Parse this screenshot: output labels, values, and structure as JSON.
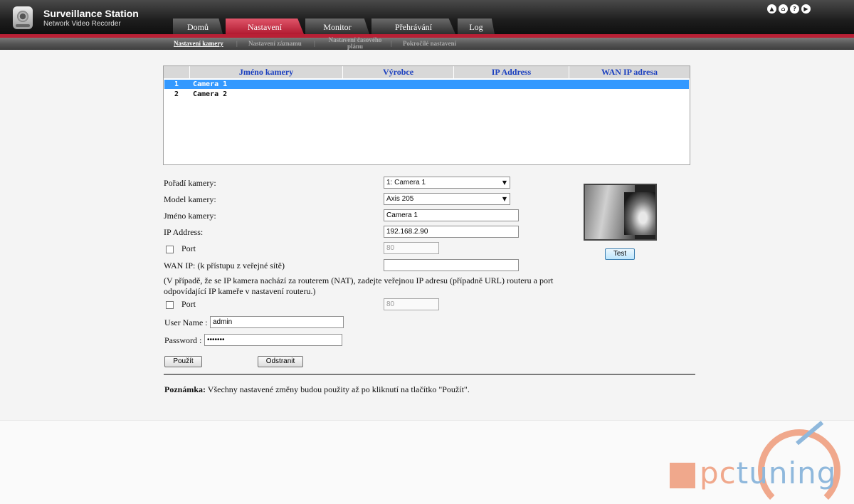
{
  "app": {
    "title": "Surveillance Station",
    "subtitle": "Network Video Recorder"
  },
  "top_icons": [
    "up-arrow-icon",
    "home-icon",
    "help-icon",
    "logout-icon"
  ],
  "tabs": [
    "Domů",
    "Nastavení",
    "Monitor",
    "Přehrávání",
    "Log"
  ],
  "active_tab": "Nastavení",
  "subnav": {
    "items": [
      "Nastavení kamery",
      "Nastavení záznamu",
      "Nastavení časového plánu",
      "Pokročilé nastavení"
    ],
    "active": "Nastavení kamery"
  },
  "camera_table": {
    "columns": [
      "Jméno kamery",
      "Výrobce",
      "IP Address",
      "WAN IP adresa"
    ],
    "rows": [
      {
        "num": "1",
        "name": "Camera 1",
        "selected": true
      },
      {
        "num": "2",
        "name": "Camera 2",
        "selected": false
      }
    ]
  },
  "form": {
    "order_label": "Pořadí kamery:",
    "order_value": "1: Camera 1",
    "model_label": "Model kamery:",
    "model_value": "Axis 205",
    "name_label": "Jméno kamery:",
    "name_value": "Camera 1",
    "ip_label": "IP Address:",
    "ip_value": "192.168.2.90",
    "port_label": "Port",
    "port_value": "80",
    "wan_label": "WAN IP: (k přístupu z veřejné sítě)",
    "wan_value": "",
    "wan_note_line1": "(V případě, že se IP kamera nachází za routerem (NAT), zadejte veřejnou IP adresu (případně URL) routeru a port",
    "wan_note_line2": "odpovídající IP kameře v nastavení routeru.)",
    "wan_port_label": "Port",
    "wan_port_value": "80",
    "user_label": "User Name :",
    "user_value": "admin",
    "password_label": "Password :",
    "password_value": "•••••••"
  },
  "buttons": {
    "apply": "Použít",
    "remove": "Odstranit",
    "test": "Test"
  },
  "note": {
    "label": "Poznámka:",
    "text": " Všechny nastavené změny budou použity až po kliknutí na tlačítko \"Použít\"."
  },
  "watermark": {
    "part1": "pc",
    "part2": "tuning"
  },
  "colors": {
    "accent_red": "#b82035",
    "header_link_blue": "#1a3fbf",
    "selection_blue": "#3399ff"
  }
}
